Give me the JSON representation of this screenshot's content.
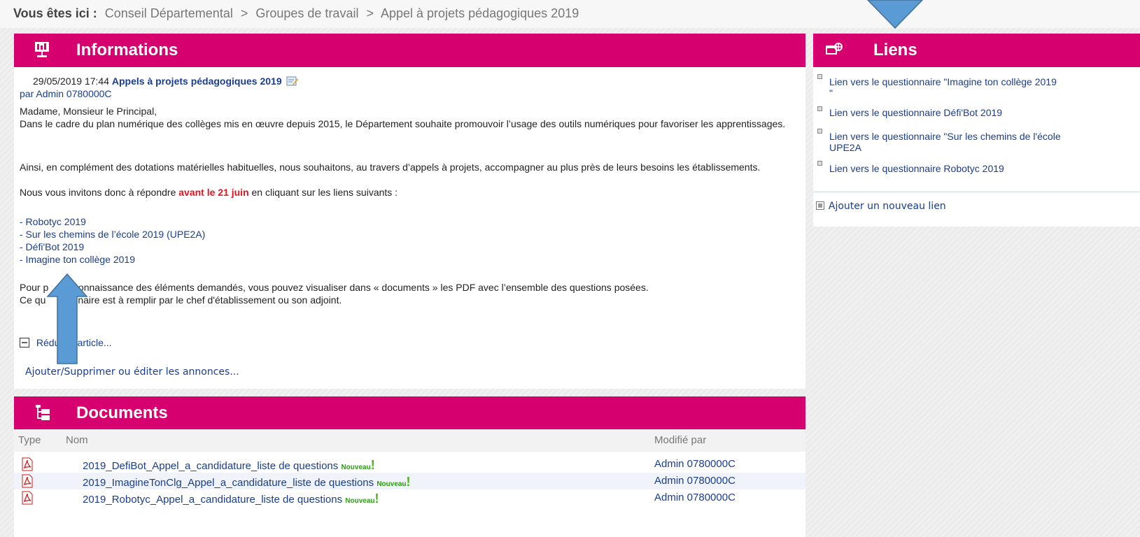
{
  "breadcrumb": {
    "lead": "Vous êtes ici :",
    "items": [
      "Conseil Départemental",
      "Groupes de travail",
      "Appel à projets pédagogiques 2019"
    ],
    "separator": ">"
  },
  "informations": {
    "title": "Informations",
    "date": "29/05/2019 17:44",
    "article_title": "Appels à projets pédagogiques 2019",
    "author": "par Admin 0780000C",
    "greeting": "Madame, Monsieur le Principal,",
    "para1": "Dans le cadre du plan numérique des collèges mis en œuvre depuis 2015, le Département souhaite promouvoir l’usage des outils numériques pour favoriser les apprentissages.",
    "para2": "Ainsi, en complément des dotations matérielles habituelles, nous souhaitons, au travers d’appels à projets, accompagner au plus près de leurs besoins les établissements.",
    "para3_before": "Nous vous invitons donc à répondre ",
    "para3_highlight": "avant le 21 juin",
    "para3_after": " en cliquant sur les liens suivants :",
    "project_links": [
      "- Robotyc 2019",
      "- Sur les chemins de l’école 2019 (UPE2A)",
      "- Défi'Bot 2019",
      "- Imagine ton collège 2019"
    ],
    "para4_a": "Pour p",
    "para4_b": "e connaissance des éléments  demandés, vous pouvez visualiser dans « documents » les PDF avec l’ensemble des questions posées.",
    "para5_a": "Ce qu",
    "para5_b": "naire est à remplir par le chef d'établissement ou son adjoint.",
    "reduce_label": "Réduire l'article...",
    "edit_label": "Ajouter/Supprimer ou éditer les annonces..."
  },
  "liens": {
    "title": "Liens",
    "items": [
      "Lien vers le questionnaire \"Imagine ton collège 2019",
      "\"",
      "Lien vers le questionnaire Défi'Bot 2019",
      "Lien vers le questionnaire \"Sur les chemins de l'école",
      "UPE2A",
      "Lien vers le questionnaire Robotyc 2019"
    ],
    "add_label": "Ajouter un nouveau lien"
  },
  "documents": {
    "title": "Documents",
    "columns": [
      "Type",
      "Nom",
      "Modifié par"
    ],
    "rows": [
      {
        "name": "2019_DefiBot_Appel_a_candidature_liste de questions",
        "badge": "Nouveau",
        "modified_by": "Admin 0780000C"
      },
      {
        "name": "2019_ImagineTonClg_Appel_a_candidature_liste de questions",
        "badge": "Nouveau",
        "modified_by": "Admin 0780000C"
      },
      {
        "name": "2019_Robotyc_Appel_a_candidature_liste de questions",
        "badge": "Nouveau",
        "modified_by": "Admin 0780000C"
      }
    ],
    "bang": "!"
  },
  "colors": {
    "header": "#d6006e",
    "link": "#1a3d8f",
    "deadline": "#e0141e",
    "arrow": "#5b9bd5"
  },
  "icons": {
    "informations": "presentation-board-icon",
    "liens": "link-globe-icon",
    "documents": "folder-tree-icon",
    "pdf": "pdf-file-icon",
    "collapse": "minus-box-icon",
    "add_link": "add-square-icon"
  }
}
